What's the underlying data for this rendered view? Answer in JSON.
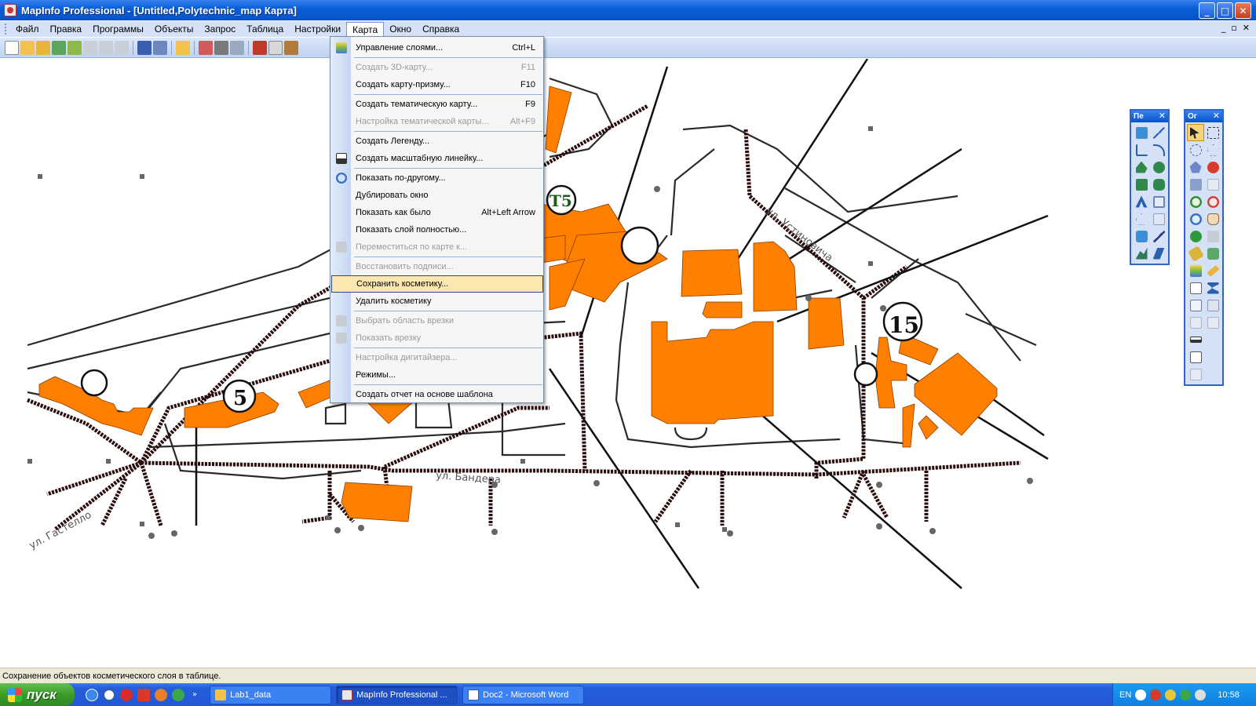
{
  "window": {
    "title": "MapInfo Professional - [Untitled,Polytechnic_map Карта]",
    "buttons": {
      "minimize": "_",
      "maximize": "□",
      "close": "✕"
    }
  },
  "menubar": {
    "items": [
      "Файл",
      "Правка",
      "Программы",
      "Объекты",
      "Запрос",
      "Таблица",
      "Настройки",
      "Карта",
      "Окно",
      "Справка"
    ],
    "open_item": "Карта",
    "mdi_buttons": {
      "minimize": "_",
      "restore": "▫",
      "close": "✕"
    }
  },
  "map_menu": [
    {
      "label": "Управление слоями...",
      "shortcut": "Ctrl+L",
      "disabled": false,
      "icon": "layers-icon"
    },
    {
      "label": "Создать 3D-карту...",
      "shortcut": "F11",
      "disabled": true
    },
    {
      "label": "Создать карту-призму...",
      "shortcut": "F10",
      "disabled": false
    },
    {
      "label": "Создать тематическую карту...",
      "shortcut": "F9",
      "disabled": false
    },
    {
      "label": "Настройка тематической карты...",
      "shortcut": "Alt+F9",
      "disabled": true
    },
    {
      "label": "Создать Легенду...",
      "shortcut": "",
      "disabled": false
    },
    {
      "label": "Создать масштабную линейку...",
      "shortcut": "",
      "disabled": false,
      "icon": "scale-bar-icon"
    },
    {
      "label": "Показать по-другому...",
      "shortcut": "",
      "disabled": false,
      "icon": "zoom-icon"
    },
    {
      "label": "Дублировать окно",
      "shortcut": "",
      "disabled": false
    },
    {
      "label": "Показать как было",
      "shortcut": "Alt+Left Arrow",
      "disabled": false
    },
    {
      "label": "Показать слой полностью...",
      "shortcut": "",
      "disabled": false
    },
    {
      "label": "Переместиться по карте к...",
      "shortcut": "",
      "disabled": true,
      "icon": "move-to-icon"
    },
    {
      "label": "Восстановить подписи...",
      "shortcut": "",
      "disabled": true
    },
    {
      "label": "Сохранить косметику...",
      "shortcut": "",
      "disabled": false,
      "highlighted": true
    },
    {
      "label": "Удалить косметику",
      "shortcut": "",
      "disabled": false
    },
    {
      "label": "Выбрать область врезки",
      "shortcut": "",
      "disabled": true,
      "icon": "inset-select-icon"
    },
    {
      "label": "Показать врезку",
      "shortcut": "",
      "disabled": true,
      "icon": "inset-show-icon"
    },
    {
      "label": "Настройка дигитайзера...",
      "shortcut": "",
      "disabled": true
    },
    {
      "label": "Режимы...",
      "shortcut": "",
      "disabled": false
    },
    {
      "label": "Создать отчет на основе шаблона",
      "shortcut": "",
      "disabled": false
    }
  ],
  "map": {
    "markers": [
      "5",
      "15",
      "Т5"
    ],
    "street_labels": [
      "ул. Гастелло",
      "ул. Бандера",
      "ул. Устиновича"
    ],
    "colors": {
      "building": "#ff7f00",
      "road": "#2a0c0c",
      "line": "#111111"
    }
  },
  "palettes": {
    "drawing": {
      "title": "Пе",
      "close": "✕"
    },
    "tools": {
      "title": "Ог",
      "close": "✕"
    }
  },
  "statusbar": {
    "text": "Сохранение объектов косметического слоя в таблице."
  },
  "taskbar": {
    "start": "пуск",
    "tasks": [
      "Lab1_data",
      "MapInfo Professional ...",
      "Doc2 - Microsoft Word"
    ],
    "language": "EN",
    "clock": "10:58"
  }
}
